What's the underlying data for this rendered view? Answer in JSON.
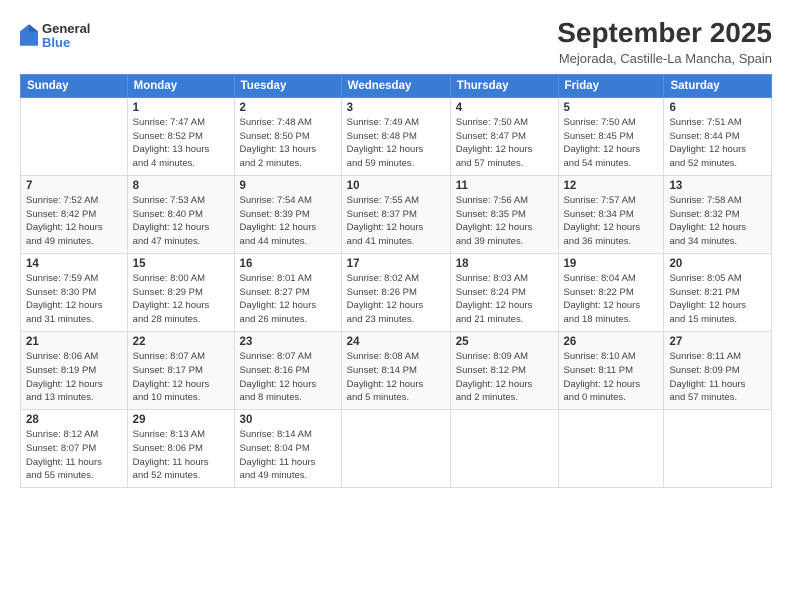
{
  "logo": {
    "general": "General",
    "blue": "Blue"
  },
  "header": {
    "title": "September 2025",
    "subtitle": "Mejorada, Castille-La Mancha, Spain"
  },
  "weekdays": [
    "Sunday",
    "Monday",
    "Tuesday",
    "Wednesday",
    "Thursday",
    "Friday",
    "Saturday"
  ],
  "weeks": [
    [
      {
        "day": "",
        "info": ""
      },
      {
        "day": "1",
        "info": "Sunrise: 7:47 AM\nSunset: 8:52 PM\nDaylight: 13 hours\nand 4 minutes."
      },
      {
        "day": "2",
        "info": "Sunrise: 7:48 AM\nSunset: 8:50 PM\nDaylight: 13 hours\nand 2 minutes."
      },
      {
        "day": "3",
        "info": "Sunrise: 7:49 AM\nSunset: 8:48 PM\nDaylight: 12 hours\nand 59 minutes."
      },
      {
        "day": "4",
        "info": "Sunrise: 7:50 AM\nSunset: 8:47 PM\nDaylight: 12 hours\nand 57 minutes."
      },
      {
        "day": "5",
        "info": "Sunrise: 7:50 AM\nSunset: 8:45 PM\nDaylight: 12 hours\nand 54 minutes."
      },
      {
        "day": "6",
        "info": "Sunrise: 7:51 AM\nSunset: 8:44 PM\nDaylight: 12 hours\nand 52 minutes."
      }
    ],
    [
      {
        "day": "7",
        "info": "Sunrise: 7:52 AM\nSunset: 8:42 PM\nDaylight: 12 hours\nand 49 minutes."
      },
      {
        "day": "8",
        "info": "Sunrise: 7:53 AM\nSunset: 8:40 PM\nDaylight: 12 hours\nand 47 minutes."
      },
      {
        "day": "9",
        "info": "Sunrise: 7:54 AM\nSunset: 8:39 PM\nDaylight: 12 hours\nand 44 minutes."
      },
      {
        "day": "10",
        "info": "Sunrise: 7:55 AM\nSunset: 8:37 PM\nDaylight: 12 hours\nand 41 minutes."
      },
      {
        "day": "11",
        "info": "Sunrise: 7:56 AM\nSunset: 8:35 PM\nDaylight: 12 hours\nand 39 minutes."
      },
      {
        "day": "12",
        "info": "Sunrise: 7:57 AM\nSunset: 8:34 PM\nDaylight: 12 hours\nand 36 minutes."
      },
      {
        "day": "13",
        "info": "Sunrise: 7:58 AM\nSunset: 8:32 PM\nDaylight: 12 hours\nand 34 minutes."
      }
    ],
    [
      {
        "day": "14",
        "info": "Sunrise: 7:59 AM\nSunset: 8:30 PM\nDaylight: 12 hours\nand 31 minutes."
      },
      {
        "day": "15",
        "info": "Sunrise: 8:00 AM\nSunset: 8:29 PM\nDaylight: 12 hours\nand 28 minutes."
      },
      {
        "day": "16",
        "info": "Sunrise: 8:01 AM\nSunset: 8:27 PM\nDaylight: 12 hours\nand 26 minutes."
      },
      {
        "day": "17",
        "info": "Sunrise: 8:02 AM\nSunset: 8:26 PM\nDaylight: 12 hours\nand 23 minutes."
      },
      {
        "day": "18",
        "info": "Sunrise: 8:03 AM\nSunset: 8:24 PM\nDaylight: 12 hours\nand 21 minutes."
      },
      {
        "day": "19",
        "info": "Sunrise: 8:04 AM\nSunset: 8:22 PM\nDaylight: 12 hours\nand 18 minutes."
      },
      {
        "day": "20",
        "info": "Sunrise: 8:05 AM\nSunset: 8:21 PM\nDaylight: 12 hours\nand 15 minutes."
      }
    ],
    [
      {
        "day": "21",
        "info": "Sunrise: 8:06 AM\nSunset: 8:19 PM\nDaylight: 12 hours\nand 13 minutes."
      },
      {
        "day": "22",
        "info": "Sunrise: 8:07 AM\nSunset: 8:17 PM\nDaylight: 12 hours\nand 10 minutes."
      },
      {
        "day": "23",
        "info": "Sunrise: 8:07 AM\nSunset: 8:16 PM\nDaylight: 12 hours\nand 8 minutes."
      },
      {
        "day": "24",
        "info": "Sunrise: 8:08 AM\nSunset: 8:14 PM\nDaylight: 12 hours\nand 5 minutes."
      },
      {
        "day": "25",
        "info": "Sunrise: 8:09 AM\nSunset: 8:12 PM\nDaylight: 12 hours\nand 2 minutes."
      },
      {
        "day": "26",
        "info": "Sunrise: 8:10 AM\nSunset: 8:11 PM\nDaylight: 12 hours\nand 0 minutes."
      },
      {
        "day": "27",
        "info": "Sunrise: 8:11 AM\nSunset: 8:09 PM\nDaylight: 11 hours\nand 57 minutes."
      }
    ],
    [
      {
        "day": "28",
        "info": "Sunrise: 8:12 AM\nSunset: 8:07 PM\nDaylight: 11 hours\nand 55 minutes."
      },
      {
        "day": "29",
        "info": "Sunrise: 8:13 AM\nSunset: 8:06 PM\nDaylight: 11 hours\nand 52 minutes."
      },
      {
        "day": "30",
        "info": "Sunrise: 8:14 AM\nSunset: 8:04 PM\nDaylight: 11 hours\nand 49 minutes."
      },
      {
        "day": "",
        "info": ""
      },
      {
        "day": "",
        "info": ""
      },
      {
        "day": "",
        "info": ""
      },
      {
        "day": "",
        "info": ""
      }
    ]
  ]
}
